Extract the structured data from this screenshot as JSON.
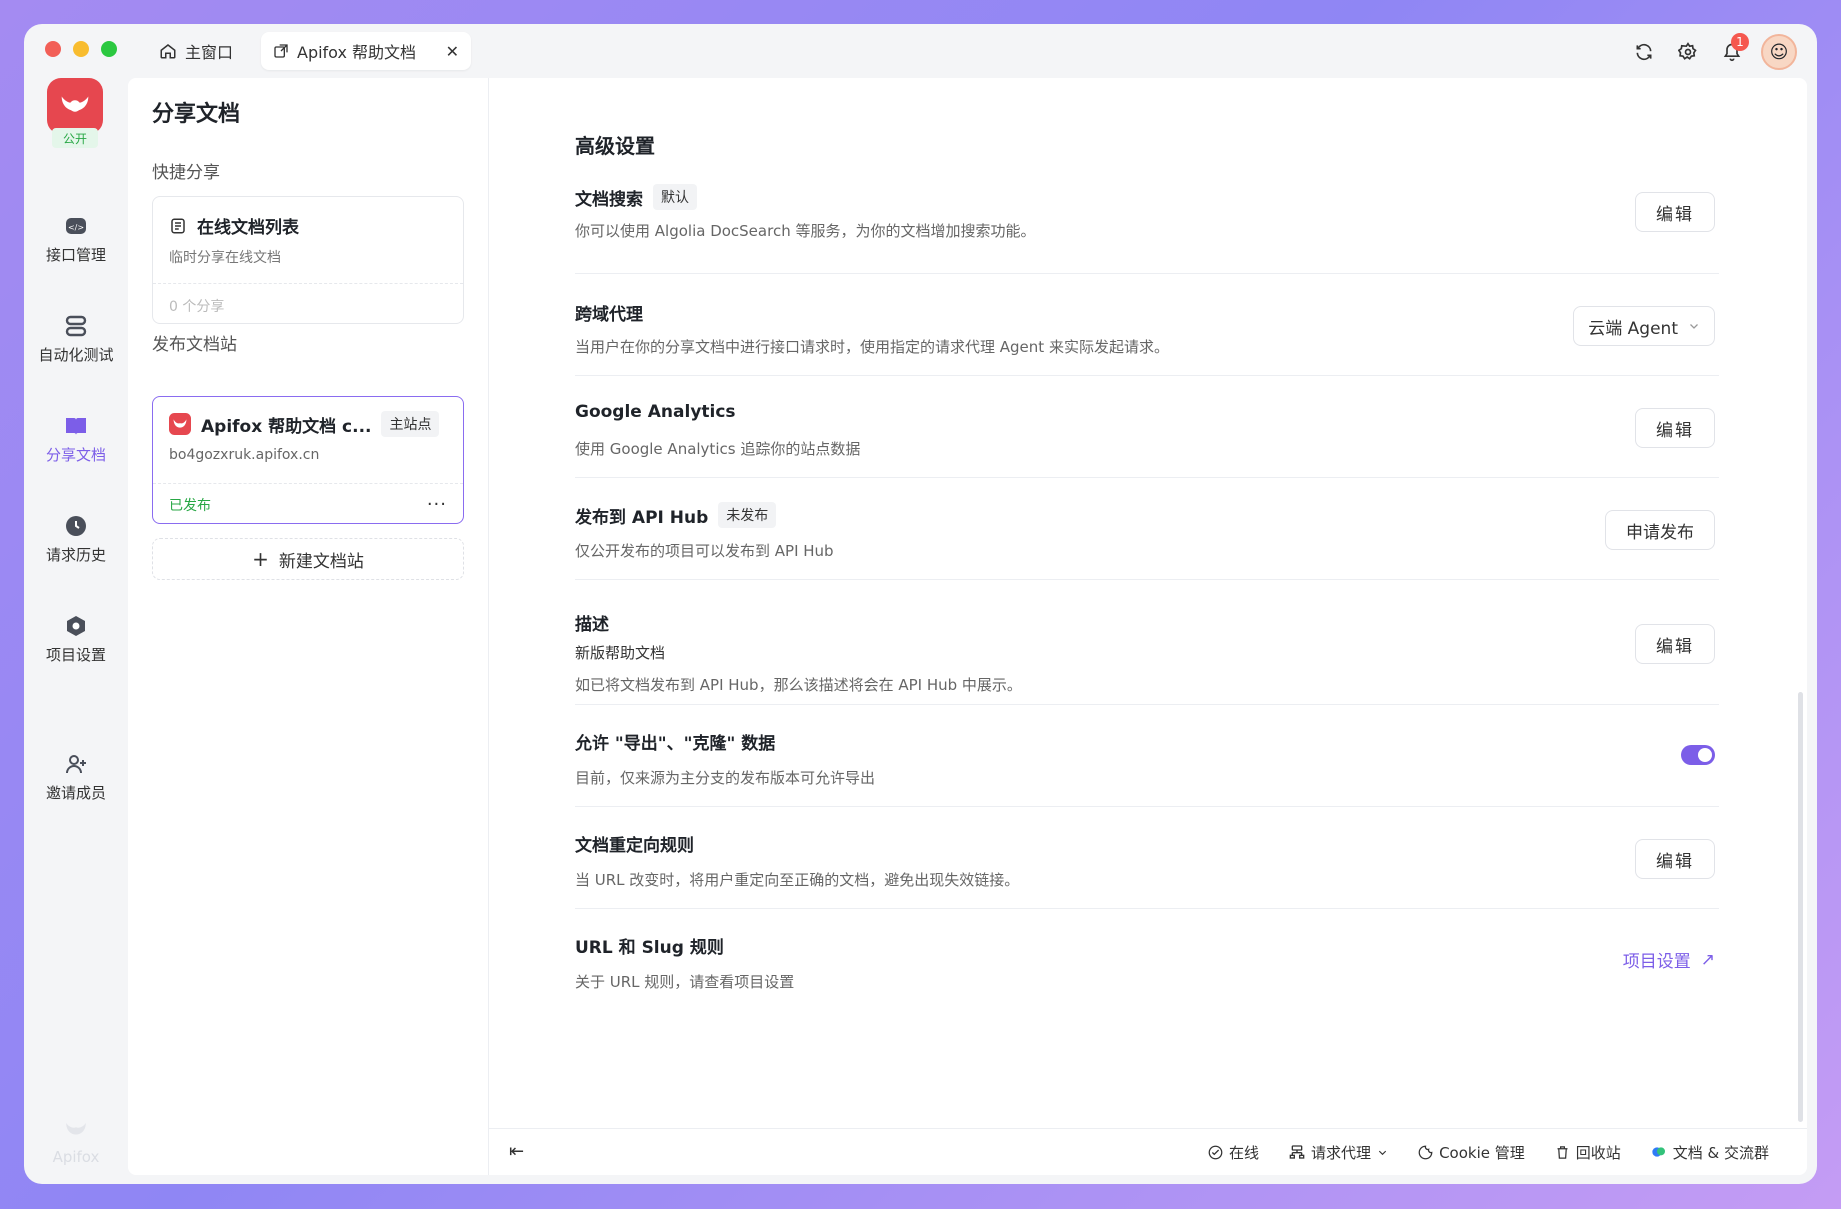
{
  "titlebar": {
    "traffic_colors": [
      "#f25f57",
      "#f8bc2f",
      "#2bc840"
    ],
    "tabs": [
      {
        "label": "主窗口",
        "icon": "home-icon"
      },
      {
        "label": "Apifox 帮助文档",
        "icon": "external-doc-icon",
        "close": "✕"
      }
    ],
    "notification_count": "1"
  },
  "rail": {
    "project_tag": "公开",
    "items": [
      {
        "label": "接口管理",
        "icon": "api-management-icon"
      },
      {
        "label": "自动化测试",
        "icon": "automation-test-icon"
      },
      {
        "label": "分享文档",
        "icon": "share-docs-icon",
        "active": true
      },
      {
        "label": "请求历史",
        "icon": "history-clock-icon"
      },
      {
        "label": "项目设置",
        "icon": "project-settings-icon"
      },
      {
        "label": "邀请成员",
        "icon": "invite-member-icon"
      }
    ],
    "brand": "Apifox"
  },
  "panel": {
    "title": "分享文档",
    "quick_share_label": "快捷分享",
    "online_card": {
      "title": "在线文档列表",
      "subtitle": "临时分享在线文档",
      "count": "0 个分享"
    },
    "publish_label": "发布文档站",
    "site_card": {
      "title": "Apifox 帮助文档 c...",
      "chip": "主站点",
      "domain": "bo4gozxruk.apifox.cn",
      "status": "已发布",
      "more": "···"
    },
    "new_site_plus": "+",
    "new_site": "新建文档站"
  },
  "main": {
    "heading": "高级设置",
    "settings": {
      "search": {
        "title": "文档搜索",
        "tag": "默认",
        "desc": "你可以使用 Algolia DocSearch 等服务，为你的文档增加搜索功能。",
        "button": "编辑"
      },
      "proxy": {
        "title": "跨域代理",
        "desc": "当用户在你的分享文档中进行接口请求时，使用指定的请求代理 Agent 来实际发起请求。",
        "select": "云端 Agent"
      },
      "ga": {
        "title": "Google Analytics",
        "desc": "使用 Google Analytics 追踪你的站点数据",
        "button": "编辑"
      },
      "hub": {
        "title": "发布到 API Hub",
        "tag": "未发布",
        "desc": "仅公开发布的项目可以发布到 API Hub",
        "button": "申请发布"
      },
      "description": {
        "title": "描述",
        "value": "新版帮助文档",
        "desc": "如已将文档发布到 API Hub，那么该描述将会在 API Hub 中展示。",
        "button": "编辑"
      },
      "export": {
        "title": "允许 \"导出\"、\"克隆\" 数据",
        "desc": "目前，仅来源为主分支的发布版本可允许导出",
        "toggle": true
      },
      "redirect": {
        "title": "文档重定向规则",
        "desc": "当 URL 改变时，将用户重定向至正确的文档，避免出现失效链接。",
        "button": "编辑"
      },
      "slug": {
        "title": "URL 和 Slug 规则",
        "desc": "关于 URL 规则，请查看项目设置",
        "link": "项目设置",
        "link_arrow": "↗"
      }
    }
  },
  "footer": {
    "collapse": "⇤",
    "online": "在线",
    "proxy": "请求代理",
    "cookie": "Cookie 管理",
    "trash": "回收站",
    "community": "文档 & 交流群"
  },
  "colors": {
    "accent": "#7c5ee8",
    "success": "#28a745",
    "brand_red": "#e6474f"
  }
}
